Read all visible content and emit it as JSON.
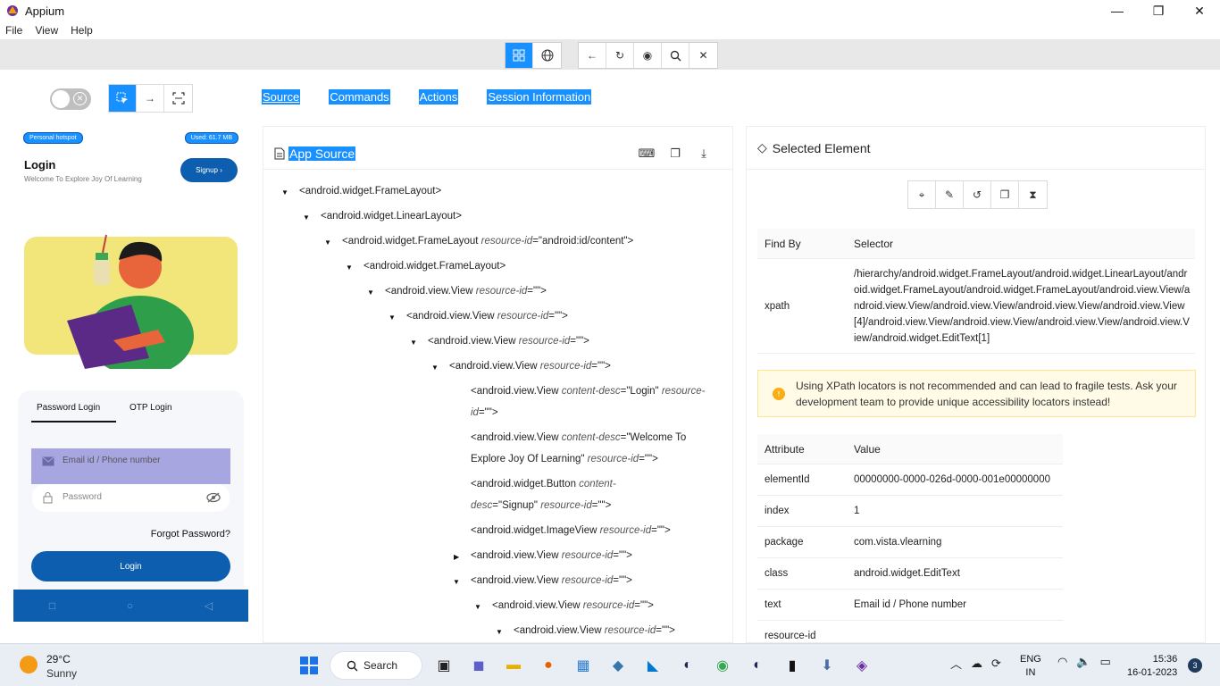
{
  "window": {
    "title": "Appium"
  },
  "menu": [
    "File",
    "View",
    "Help"
  ],
  "tabs": [
    "Source",
    "Commands",
    "Actions",
    "Session Information"
  ],
  "device": {
    "status_left": "Personal hotspot",
    "status_right": "Used: 61.7 MB",
    "title": "Login",
    "subtitle": "Welcome To Explore Joy Of Learning",
    "signup": "Signup ›",
    "tab_password": "Password Login",
    "tab_otp": "OTP Login",
    "email_placeholder": "Email id / Phone number",
    "password_placeholder": "Password",
    "forgot": "Forgot Password?",
    "login_button": "Login"
  },
  "source": {
    "title": "App Source",
    "lines": [
      {
        "tag": "<android.widget.FrameLayout>",
        "attrs": ""
      },
      {
        "tag": "<android.widget.LinearLayout>",
        "attrs": ""
      },
      {
        "tag": "<android.widget.FrameLayout",
        "attrs": "resource-id",
        "val": "=\"android:id/content\">"
      },
      {
        "tag": "<android.widget.FrameLayout>",
        "attrs": ""
      },
      {
        "tag": "<android.view.View",
        "attrs": "resource-id",
        "val": "=\"\">"
      },
      {
        "tag": "<android.view.View",
        "attrs": "resource-id",
        "val": "=\"\">"
      },
      {
        "tag": "<android.view.View",
        "attrs": "resource-id",
        "val": "=\"\">"
      },
      {
        "tag": "<android.view.View",
        "attrs": "resource-id",
        "val": "=\"\">"
      }
    ],
    "leaf1_a": "<android.view.View ",
    "leaf1_b": "content-desc",
    "leaf1_c": "=\"Login\" ",
    "leaf1_d": "resource-",
    "leaf1_e": "id",
    "leaf1_f": "=\"\">",
    "leaf2_a": "<android.view.View ",
    "leaf2_b": "content-desc",
    "leaf2_c": "=\"Welcome To",
    "leaf2_d": "Explore Joy Of Learning\" ",
    "leaf2_e": "resource-id",
    "leaf2_f": "=\"\">",
    "leaf3_a": "<android.widget.Button ",
    "leaf3_b": "content-",
    "leaf3_c": "desc",
    "leaf3_d": "=\"Signup\" ",
    "leaf3_e": "resource-id",
    "leaf3_f": "=\"\">",
    "leaf4_a": "<android.widget.ImageView ",
    "leaf4_b": "resource-id",
    "leaf4_c": "=\"\">",
    "leaf5_a": "<android.view.View ",
    "leaf5_b": "resource-id",
    "leaf5_c": "=\"\">",
    "leaf6_a": "<android.view.View ",
    "leaf6_b": "resource-id",
    "leaf6_c": "=\"\">",
    "leaf7_a": "<android.view.View ",
    "leaf7_b": "resource-id",
    "leaf7_c": "=\"\">",
    "leaf8_a": "<android.view.View ",
    "leaf8_b": "resource-id",
    "leaf8_c": "=\"\">"
  },
  "selected": {
    "title": "Selected Element",
    "findby_header": "Find By",
    "selector_header": "Selector",
    "xpath_label": "xpath",
    "xpath_value": "/hierarchy/android.widget.FrameLayout/android.widget.LinearLayout/android.widget.FrameLayout/android.widget.FrameLayout/android.view.View/android.view.View/android.view.View/android.view.View/android.view.View[4]/android.view.View/android.view.View/android.view.View/android.view.View/android.widget.EditText[1]",
    "warning": "Using XPath locators is not recommended and can lead to fragile tests. Ask your development team to provide unique accessibility locators instead!",
    "attr_header": "Attribute",
    "value_header": "Value",
    "attributes": [
      {
        "k": "elementId",
        "v": "00000000-0000-026d-0000-001e00000000"
      },
      {
        "k": "index",
        "v": "1"
      },
      {
        "k": "package",
        "v": "com.vista.vlearning"
      },
      {
        "k": "class",
        "v": "android.widget.EditText"
      },
      {
        "k": "text",
        "v": "Email id / Phone number"
      },
      {
        "k": "resource-id",
        "v": ""
      }
    ]
  },
  "taskbar": {
    "temp": "29°C",
    "condition": "Sunny",
    "search": "Search",
    "lang1": "ENG",
    "lang2": "IN",
    "time": "15:36",
    "date": "16-01-2023",
    "notifications": "3"
  },
  "colors": {
    "accent": "#1890ff",
    "device_primary": "#0d5eaf",
    "warning_bg": "#fffbe6"
  }
}
